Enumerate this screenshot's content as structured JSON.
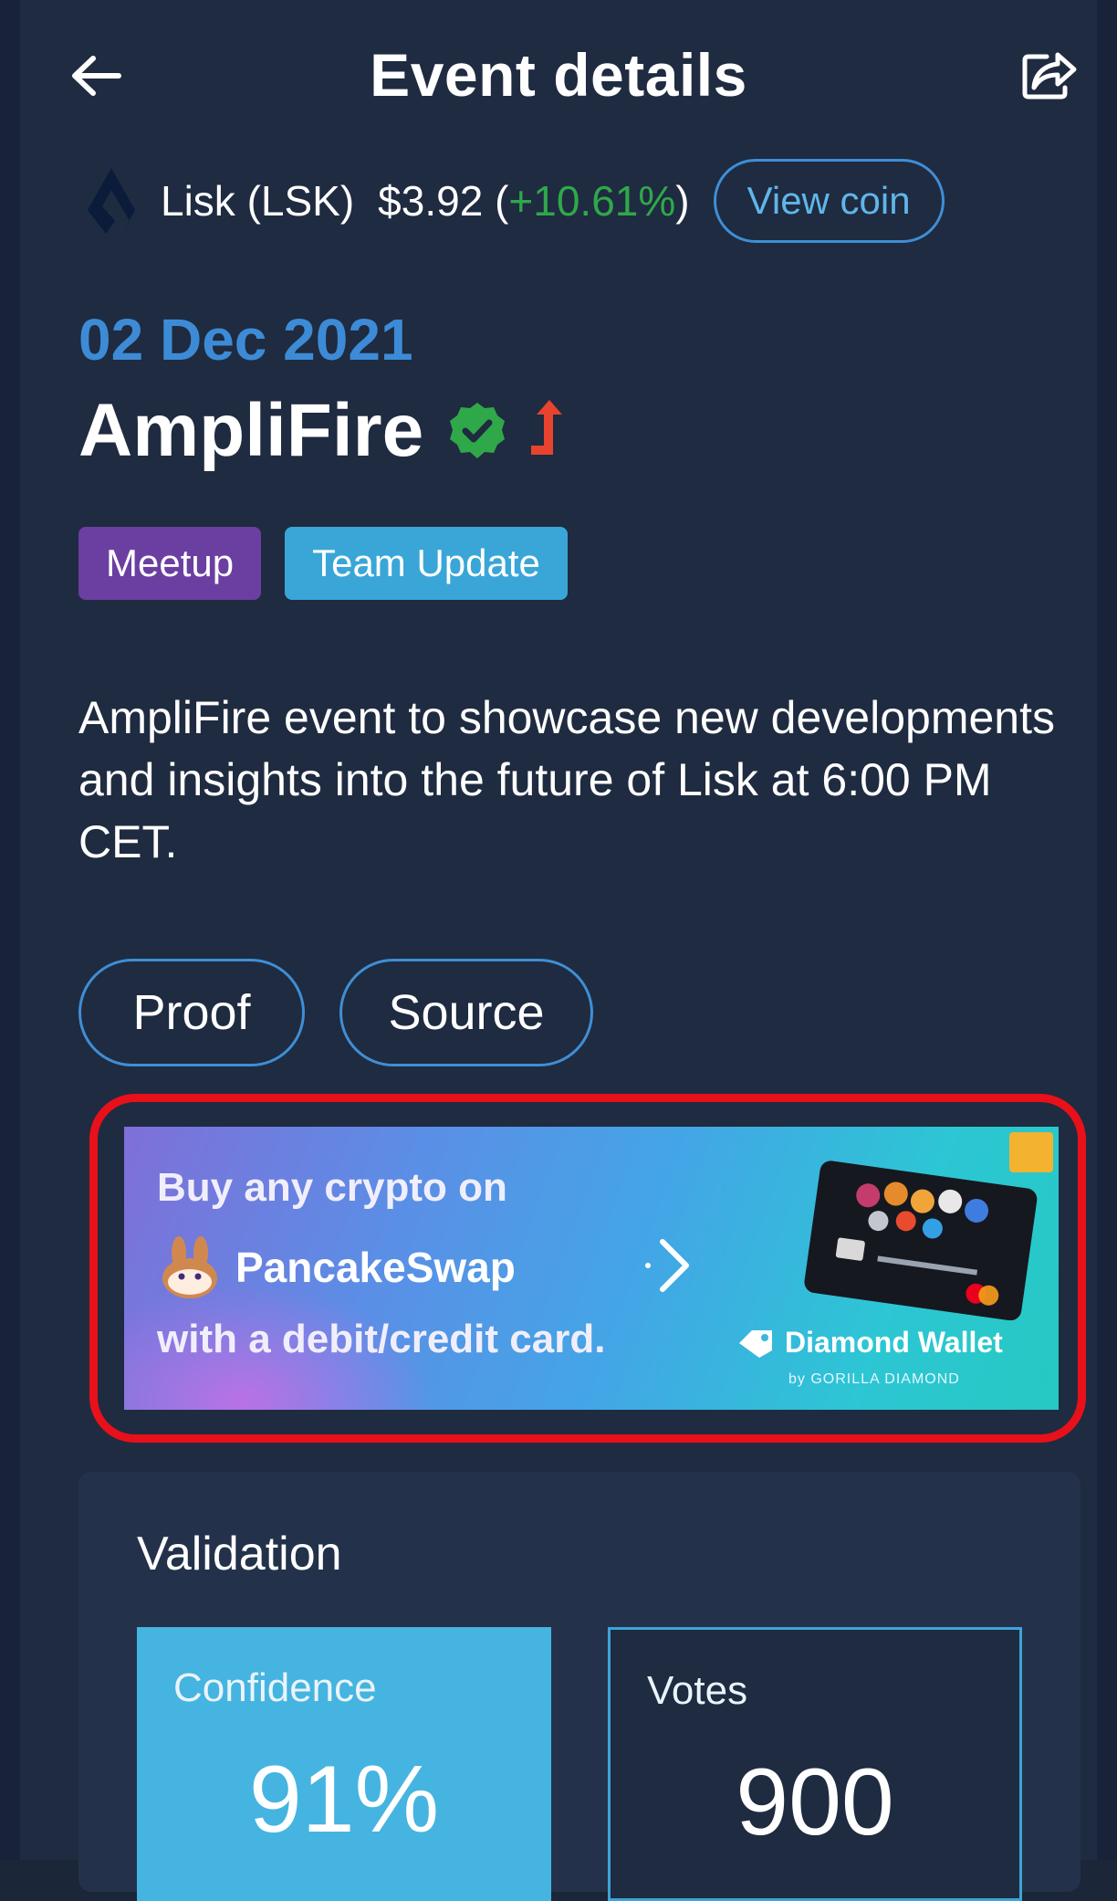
{
  "header": {
    "title": "Event details",
    "back_icon": "arrow-left-icon",
    "share_icon": "share-icon"
  },
  "coin": {
    "name": "Lisk (LSK)",
    "price_prefix": "$3.92 (",
    "change": "+10.61%",
    "price_suffix": ")",
    "view_label": "View coin",
    "change_color": "#2fa84a"
  },
  "event": {
    "date": "02 Dec 2021",
    "title": "AmpliFire",
    "tags": [
      "Meetup",
      "Team Update"
    ],
    "description": "AmpliFire event to showcase new developments and insights into the future of Lisk at 6:00 PM CET."
  },
  "links": {
    "proof_label": "Proof",
    "source_label": "Source"
  },
  "ad": {
    "line1": "Buy any crypto on",
    "brand": "PancakeSwap",
    "line3": "with a debit/credit card.",
    "wallet": "Diamond Wallet",
    "wallet_sub": "by GORILLA DIAMOND"
  },
  "validation": {
    "title": "Validation",
    "confidence_label": "Confidence",
    "confidence_value": "91%",
    "votes_label": "Votes",
    "votes_value": "900"
  },
  "colors": {
    "background": "#1f2b40",
    "accent_blue": "#3d8bd6",
    "highlight_red": "#e8101a",
    "meetup_tag": "#6b3fa2",
    "team_tag": "#3aa6d8"
  }
}
